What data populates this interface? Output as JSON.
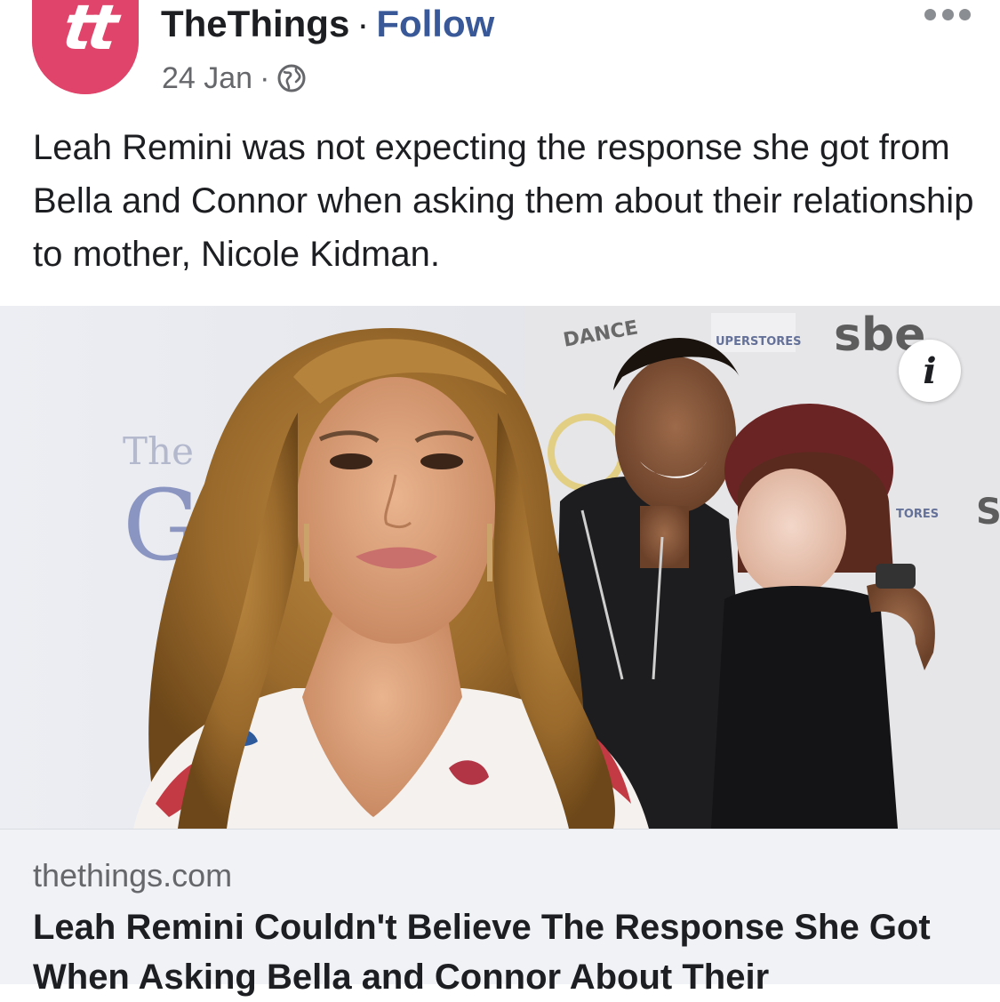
{
  "header": {
    "avatar_text": "tt",
    "page_name": "TheThings",
    "separator": "·",
    "follow_label": "Follow",
    "date": "24 Jan",
    "meta_separator": "·",
    "privacy_icon": "globe-icon",
    "more_icon": "more-options-icon"
  },
  "post": {
    "caption": "Leah Remini was not expecting the response she got from Bella and Connor when asking them about their relationship to mother, Nicole Kidman."
  },
  "link_preview": {
    "image_description_icon": "info-icon",
    "info_glyph": "i",
    "domain": "thethings.com",
    "title": "Leah Remini Couldn't Believe The Response She Got When Asking Bella and Connor About Their"
  },
  "colors": {
    "brand_avatar": "#e0446a",
    "link_blue": "#385898",
    "secondary_text": "#65676b",
    "footer_bg": "#f0f2f5"
  }
}
